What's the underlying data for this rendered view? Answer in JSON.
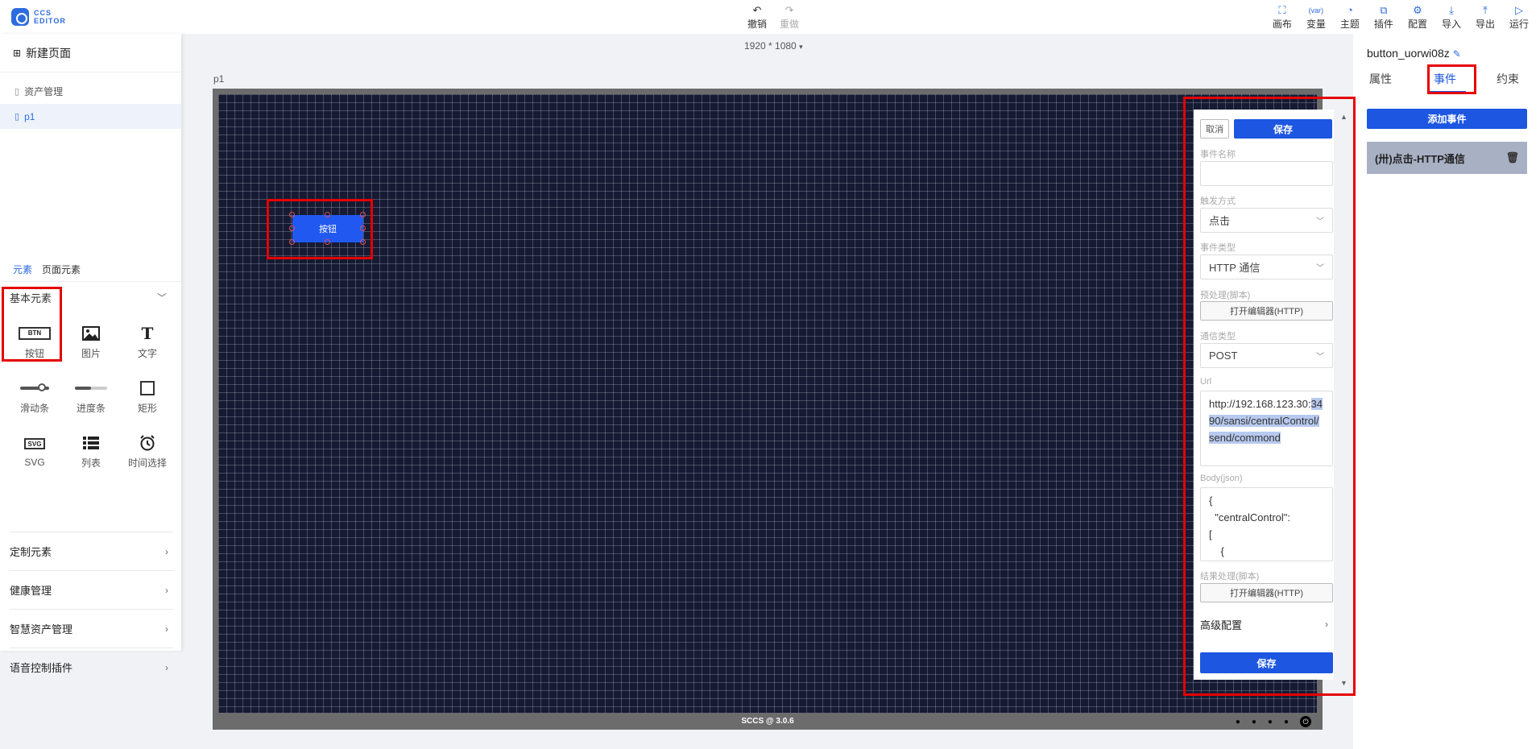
{
  "app": {
    "logo_line1": "CCS",
    "logo_line2": "EDITOR"
  },
  "toolbar": {
    "undo": "撤销",
    "redo": "重做",
    "tools": [
      {
        "label": "画布",
        "icon": "canvas-icon"
      },
      {
        "label": "变量",
        "icon": "variable-icon"
      },
      {
        "label": "主题",
        "icon": "theme-icon"
      },
      {
        "label": "插件",
        "icon": "plugin-icon"
      },
      {
        "label": "配置",
        "icon": "settings-icon"
      },
      {
        "label": "导入",
        "icon": "import-icon"
      },
      {
        "label": "导出",
        "icon": "export-icon"
      },
      {
        "label": "运行",
        "icon": "run-icon"
      }
    ]
  },
  "left": {
    "new_page": "新建页面",
    "pages": [
      {
        "label": "资产管理",
        "active": false
      },
      {
        "label": "p1",
        "active": true
      }
    ],
    "tabs": {
      "elements": "元素",
      "page_elements": "页面元素"
    },
    "basic_section": "基本元素",
    "elements": [
      {
        "label": "按钮",
        "icon": "button-element-icon",
        "glyph": "BTN"
      },
      {
        "label": "图片",
        "icon": "image-element-icon",
        "glyph": ""
      },
      {
        "label": "文字",
        "icon": "text-element-icon",
        "glyph": "T"
      },
      {
        "label": "滑动条",
        "icon": "slider-element-icon",
        "glyph": ""
      },
      {
        "label": "进度条",
        "icon": "progress-element-icon",
        "glyph": ""
      },
      {
        "label": "矩形",
        "icon": "rectangle-element-icon",
        "glyph": ""
      },
      {
        "label": "SVG",
        "icon": "svg-element-icon",
        "glyph": "SVG"
      },
      {
        "label": "列表",
        "icon": "list-element-icon",
        "glyph": ""
      },
      {
        "label": "时间选择",
        "icon": "clock-element-icon",
        "glyph": ""
      }
    ],
    "categories": [
      "定制元素",
      "健康管理",
      "智慧资产管理",
      "语音控制插件"
    ]
  },
  "canvas": {
    "resolution": "1920 * 1080",
    "page_label": "p1",
    "button_text": "按钮",
    "footer": "SCCS @ 3.0.6"
  },
  "event_editor": {
    "cancel": "取消",
    "save": "保存",
    "name_label": "事件名称",
    "name_value": "",
    "trigger_label": "触发方式",
    "trigger_value": "点击",
    "type_label": "事件类型",
    "type_value": "HTTP 通信",
    "preprocess_label": "预处理(脚本)",
    "open_editor": "打开编辑器(HTTP)",
    "comm_label": "通信类型",
    "comm_value": "POST",
    "url_label": "Url",
    "url_plain": "http://192.168.123.30:",
    "url_selected": "3490/sansi/centralControl/send/commond",
    "body_label": "Body(json)",
    "body_text": "{\n  \"centralControl\":\n[\n    {",
    "result_label": "结果处理(脚本)",
    "open_editor_2": "打开编辑器(HTTP)",
    "advanced": "高级配置",
    "save_bottom": "保存"
  },
  "right": {
    "component_name": "button_uorwi08z",
    "tabs": [
      "属性",
      "事件",
      "约束"
    ],
    "active_tab": "事件",
    "add_event": "添加事件",
    "event_item": "(卅)点击-HTTP通信"
  },
  "colors": {
    "accent": "#1d56e0",
    "highlight": "#e60000",
    "canvas_bg": "#161a33"
  }
}
